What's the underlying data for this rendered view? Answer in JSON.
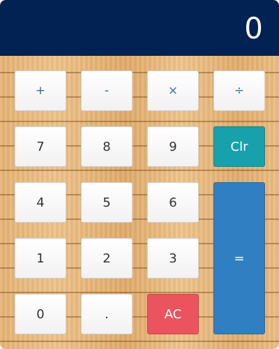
{
  "display": {
    "value": "0"
  },
  "operators": {
    "add": "+",
    "subtract": "-",
    "multiply": "×",
    "divide": "÷"
  },
  "digits": {
    "d0": "0",
    "d1": "1",
    "d2": "2",
    "d3": "3",
    "d4": "4",
    "d5": "5",
    "d6": "6",
    "d7": "7",
    "d8": "8",
    "d9": "9"
  },
  "controls": {
    "clear": "Clr",
    "all_clear": "AC",
    "equals": "=",
    "decimal": "."
  },
  "colors": {
    "display_bg": "#032254",
    "clear_bg": "#16a1ac",
    "all_clear_bg": "#e9545f",
    "equals_bg": "#2f7fc2",
    "operator_text": "#2d6fa3"
  }
}
